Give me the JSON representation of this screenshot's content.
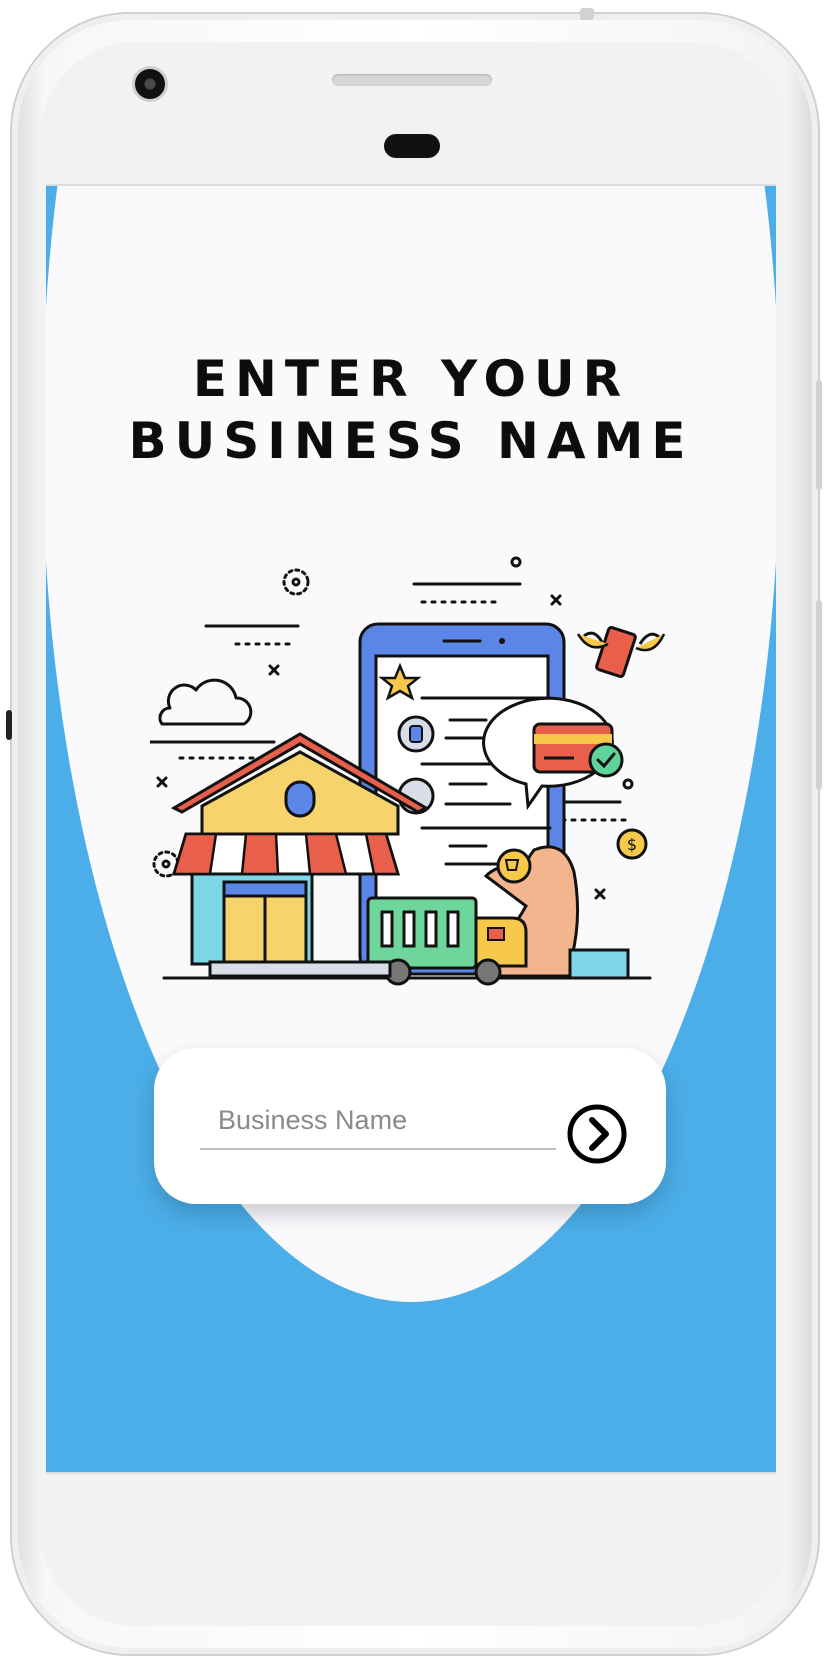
{
  "screen": {
    "title_line1": "ENTER YOUR",
    "title_line2": "BUSINESS NAME",
    "illustration_icon": "online-store-illustration",
    "form": {
      "placeholder": "Business Name",
      "value": "",
      "submit_icon": "chevron-right-circle-icon"
    }
  },
  "colors": {
    "accent_blue": "#4baee8",
    "screen_bg": "#faf9fc",
    "title": "#0d0d0d",
    "card_bg": "#ffffff"
  }
}
